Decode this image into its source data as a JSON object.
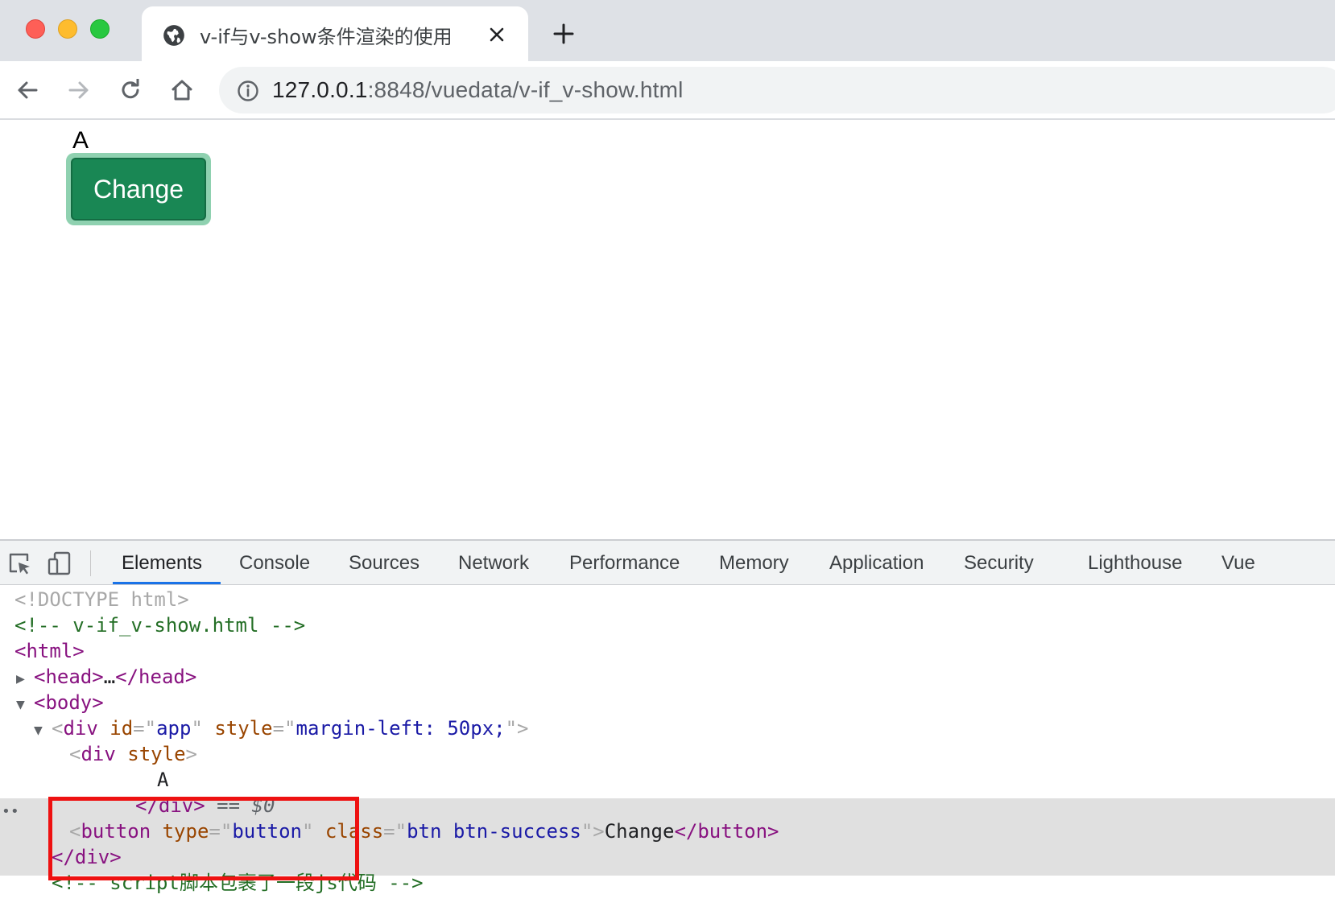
{
  "browser": {
    "tab_title": "v-if与v-show条件渲染的使用",
    "url_host": "127.0.0.1",
    "url_path": ":8848/vuedata/v-if_v-show.html"
  },
  "page": {
    "text": "A",
    "button_label": "Change",
    "button_colors": {
      "fill": "#198754",
      "focus_ring": "#8fd1b0"
    }
  },
  "devtools": {
    "tabs": [
      "Elements",
      "Console",
      "Sources",
      "Network",
      "Performance",
      "Memory",
      "Application",
      "Security",
      "Lighthouse",
      "Vue"
    ],
    "active_tab": "Elements",
    "dom": {
      "doctype": "<!DOCTYPE html>",
      "comment_file": "<!-- v-if_v-show.html -->",
      "html_open": "<html>",
      "head_open": "<head>",
      "head_ellipsis": "…",
      "head_close": "</head>",
      "body_open": "<body>",
      "div_app": {
        "tag": "div",
        "attr1_name": "id",
        "attr1_value": "app",
        "attr2_name": "style",
        "attr2_value": "margin-left: 50px;"
      },
      "selected_div": {
        "tag": "div",
        "attr_name": "style",
        "text": "A",
        "close": "</div>",
        "console_ref": "== $0"
      },
      "button": {
        "tag": "button",
        "attr1_name": "type",
        "attr1_value": "button",
        "attr2_name": "class",
        "attr2_value": "btn btn-success",
        "text": "Change",
        "close": "</button>"
      },
      "div_close": "</div>",
      "comment_script": "<!-- script脚本包裹了一段js代码 -->"
    }
  }
}
